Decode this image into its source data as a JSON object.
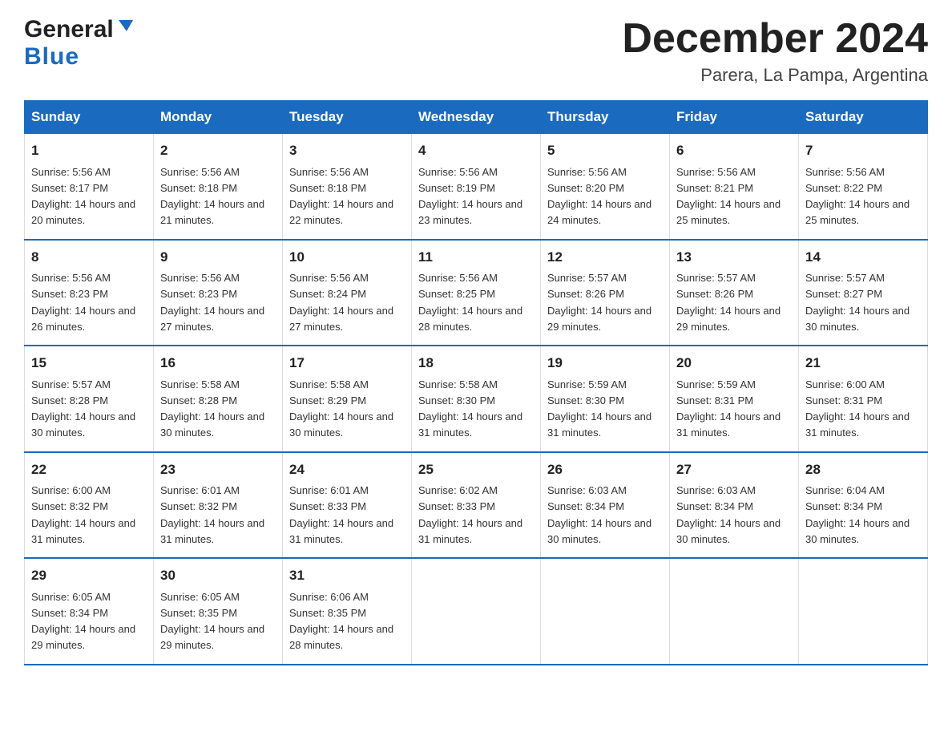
{
  "logo": {
    "general": "General",
    "blue": "Blue"
  },
  "title": "December 2024",
  "subtitle": "Parera, La Pampa, Argentina",
  "days_of_week": [
    "Sunday",
    "Monday",
    "Tuesday",
    "Wednesday",
    "Thursday",
    "Friday",
    "Saturday"
  ],
  "weeks": [
    [
      {
        "day": "1",
        "sunrise": "Sunrise: 5:56 AM",
        "sunset": "Sunset: 8:17 PM",
        "daylight": "Daylight: 14 hours and 20 minutes."
      },
      {
        "day": "2",
        "sunrise": "Sunrise: 5:56 AM",
        "sunset": "Sunset: 8:18 PM",
        "daylight": "Daylight: 14 hours and 21 minutes."
      },
      {
        "day": "3",
        "sunrise": "Sunrise: 5:56 AM",
        "sunset": "Sunset: 8:18 PM",
        "daylight": "Daylight: 14 hours and 22 minutes."
      },
      {
        "day": "4",
        "sunrise": "Sunrise: 5:56 AM",
        "sunset": "Sunset: 8:19 PM",
        "daylight": "Daylight: 14 hours and 23 minutes."
      },
      {
        "day": "5",
        "sunrise": "Sunrise: 5:56 AM",
        "sunset": "Sunset: 8:20 PM",
        "daylight": "Daylight: 14 hours and 24 minutes."
      },
      {
        "day": "6",
        "sunrise": "Sunrise: 5:56 AM",
        "sunset": "Sunset: 8:21 PM",
        "daylight": "Daylight: 14 hours and 25 minutes."
      },
      {
        "day": "7",
        "sunrise": "Sunrise: 5:56 AM",
        "sunset": "Sunset: 8:22 PM",
        "daylight": "Daylight: 14 hours and 25 minutes."
      }
    ],
    [
      {
        "day": "8",
        "sunrise": "Sunrise: 5:56 AM",
        "sunset": "Sunset: 8:23 PM",
        "daylight": "Daylight: 14 hours and 26 minutes."
      },
      {
        "day": "9",
        "sunrise": "Sunrise: 5:56 AM",
        "sunset": "Sunset: 8:23 PM",
        "daylight": "Daylight: 14 hours and 27 minutes."
      },
      {
        "day": "10",
        "sunrise": "Sunrise: 5:56 AM",
        "sunset": "Sunset: 8:24 PM",
        "daylight": "Daylight: 14 hours and 27 minutes."
      },
      {
        "day": "11",
        "sunrise": "Sunrise: 5:56 AM",
        "sunset": "Sunset: 8:25 PM",
        "daylight": "Daylight: 14 hours and 28 minutes."
      },
      {
        "day": "12",
        "sunrise": "Sunrise: 5:57 AM",
        "sunset": "Sunset: 8:26 PM",
        "daylight": "Daylight: 14 hours and 29 minutes."
      },
      {
        "day": "13",
        "sunrise": "Sunrise: 5:57 AM",
        "sunset": "Sunset: 8:26 PM",
        "daylight": "Daylight: 14 hours and 29 minutes."
      },
      {
        "day": "14",
        "sunrise": "Sunrise: 5:57 AM",
        "sunset": "Sunset: 8:27 PM",
        "daylight": "Daylight: 14 hours and 30 minutes."
      }
    ],
    [
      {
        "day": "15",
        "sunrise": "Sunrise: 5:57 AM",
        "sunset": "Sunset: 8:28 PM",
        "daylight": "Daylight: 14 hours and 30 minutes."
      },
      {
        "day": "16",
        "sunrise": "Sunrise: 5:58 AM",
        "sunset": "Sunset: 8:28 PM",
        "daylight": "Daylight: 14 hours and 30 minutes."
      },
      {
        "day": "17",
        "sunrise": "Sunrise: 5:58 AM",
        "sunset": "Sunset: 8:29 PM",
        "daylight": "Daylight: 14 hours and 30 minutes."
      },
      {
        "day": "18",
        "sunrise": "Sunrise: 5:58 AM",
        "sunset": "Sunset: 8:30 PM",
        "daylight": "Daylight: 14 hours and 31 minutes."
      },
      {
        "day": "19",
        "sunrise": "Sunrise: 5:59 AM",
        "sunset": "Sunset: 8:30 PM",
        "daylight": "Daylight: 14 hours and 31 minutes."
      },
      {
        "day": "20",
        "sunrise": "Sunrise: 5:59 AM",
        "sunset": "Sunset: 8:31 PM",
        "daylight": "Daylight: 14 hours and 31 minutes."
      },
      {
        "day": "21",
        "sunrise": "Sunrise: 6:00 AM",
        "sunset": "Sunset: 8:31 PM",
        "daylight": "Daylight: 14 hours and 31 minutes."
      }
    ],
    [
      {
        "day": "22",
        "sunrise": "Sunrise: 6:00 AM",
        "sunset": "Sunset: 8:32 PM",
        "daylight": "Daylight: 14 hours and 31 minutes."
      },
      {
        "day": "23",
        "sunrise": "Sunrise: 6:01 AM",
        "sunset": "Sunset: 8:32 PM",
        "daylight": "Daylight: 14 hours and 31 minutes."
      },
      {
        "day": "24",
        "sunrise": "Sunrise: 6:01 AM",
        "sunset": "Sunset: 8:33 PM",
        "daylight": "Daylight: 14 hours and 31 minutes."
      },
      {
        "day": "25",
        "sunrise": "Sunrise: 6:02 AM",
        "sunset": "Sunset: 8:33 PM",
        "daylight": "Daylight: 14 hours and 31 minutes."
      },
      {
        "day": "26",
        "sunrise": "Sunrise: 6:03 AM",
        "sunset": "Sunset: 8:34 PM",
        "daylight": "Daylight: 14 hours and 30 minutes."
      },
      {
        "day": "27",
        "sunrise": "Sunrise: 6:03 AM",
        "sunset": "Sunset: 8:34 PM",
        "daylight": "Daylight: 14 hours and 30 minutes."
      },
      {
        "day": "28",
        "sunrise": "Sunrise: 6:04 AM",
        "sunset": "Sunset: 8:34 PM",
        "daylight": "Daylight: 14 hours and 30 minutes."
      }
    ],
    [
      {
        "day": "29",
        "sunrise": "Sunrise: 6:05 AM",
        "sunset": "Sunset: 8:34 PM",
        "daylight": "Daylight: 14 hours and 29 minutes."
      },
      {
        "day": "30",
        "sunrise": "Sunrise: 6:05 AM",
        "sunset": "Sunset: 8:35 PM",
        "daylight": "Daylight: 14 hours and 29 minutes."
      },
      {
        "day": "31",
        "sunrise": "Sunrise: 6:06 AM",
        "sunset": "Sunset: 8:35 PM",
        "daylight": "Daylight: 14 hours and 28 minutes."
      },
      null,
      null,
      null,
      null
    ]
  ]
}
